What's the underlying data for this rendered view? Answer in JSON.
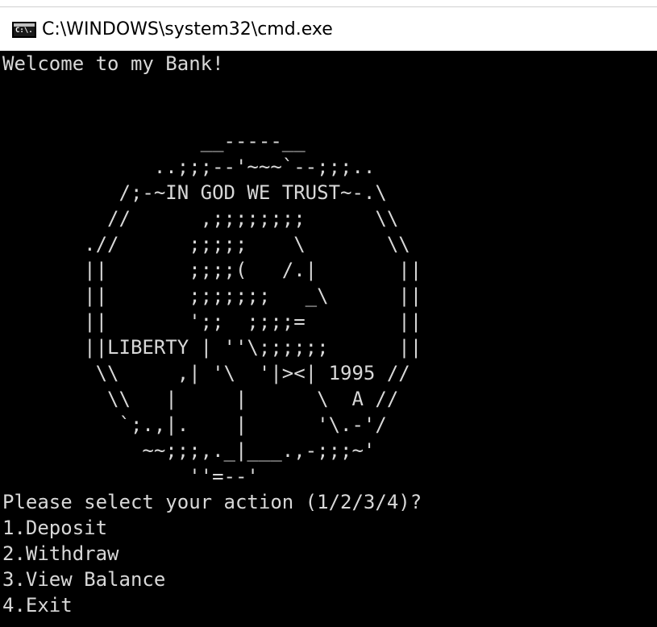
{
  "window": {
    "title": "C:\\WINDOWS\\system32\\cmd.exe",
    "icon": "cmd-console-icon",
    "icon_glyph": "C:\\."
  },
  "console": {
    "lines": [
      "Welcome to my Bank!",
      "",
      "",
      "                 __-----__",
      "             ..;;;--'~~~`--;;;..",
      "          /;-~IN GOD WE TRUST~-.\\",
      "         //      ,;;;;;;;;      \\\\",
      "       .//      ;;;;;    \\       \\\\",
      "       ||       ;;;;(   /.|       ||",
      "       ||       ;;;;;;;   _\\      ||",
      "       ||       ';;  ;;;;=        ||",
      "       ||LIBERTY | ''\\;;;;;;      ||",
      "        \\\\     ,| '\\  '|><| 1995 //",
      "         \\\\   |     |      \\  A //",
      "          `;.,|.    |      '\\.-'/",
      "            ~~;;;,._|___.,-;;;~'",
      "                ''=--'",
      "Please select your action (1/2/3/4)?",
      "1.Deposit",
      "2.Withdraw",
      "3.View Balance",
      "4.Exit"
    ]
  }
}
